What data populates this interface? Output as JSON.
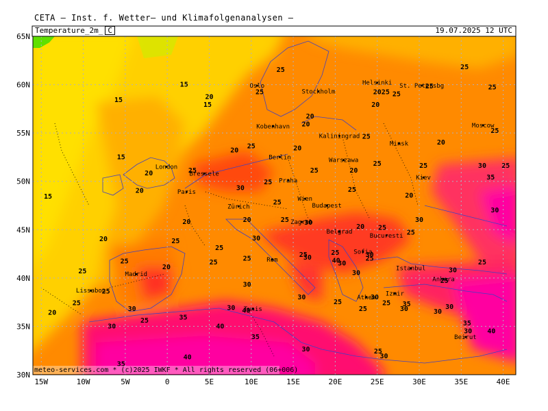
{
  "header": {
    "title": "CETA — Inst. f. Wetter— und Klimafolgenanalysen —"
  },
  "subheader": {
    "parameter": "Temperature_2m_",
    "unit": "C",
    "valid_time": "19.07.2025 12 UTC"
  },
  "footer": {
    "credit": "meteo-services.com * (c)2025 IWKF * All rights reserved (06+006)"
  },
  "map": {
    "lat_labels": [
      "65N",
      "60N",
      "55N",
      "50N",
      "45N",
      "40N",
      "35N",
      "30N"
    ],
    "lon_labels": [
      "15W",
      "10W",
      "5W",
      "0",
      "5E",
      "10E",
      "15E",
      "20E",
      "25E",
      "30E",
      "35E",
      "40E"
    ],
    "colors": {
      "temp_15": "#ffd800",
      "temp_20": "#ffb000",
      "temp_25": "#ff8a00",
      "temp_30": "#ff5a00",
      "temp_35": "#ff2a3a",
      "temp_40": "#ff00a0",
      "cold_green": "#60e000",
      "lime": "#c8f000",
      "border": "#4040c0",
      "grid": "#b0b0c0"
    },
    "cities": [
      {
        "name": "Oslo",
        "lon": 10.7,
        "lat": 59.9
      },
      {
        "name": "Stockholm",
        "lon": 18.0,
        "lat": 59.3
      },
      {
        "name": "Helsinki",
        "lon": 25.0,
        "lat": 60.2
      },
      {
        "name": "St. Petersbg",
        "lon": 30.3,
        "lat": 59.9
      },
      {
        "name": "Kobenhavn",
        "lon": 12.6,
        "lat": 55.7
      },
      {
        "name": "Kaliningrad",
        "lon": 20.5,
        "lat": 54.7
      },
      {
        "name": "Minsk",
        "lon": 27.6,
        "lat": 53.9
      },
      {
        "name": "Moscow",
        "lon": 37.6,
        "lat": 55.8
      },
      {
        "name": "London",
        "lon": -0.1,
        "lat": 51.5
      },
      {
        "name": "Berlin",
        "lon": 13.4,
        "lat": 52.5
      },
      {
        "name": "Warszawa",
        "lon": 21.0,
        "lat": 52.2
      },
      {
        "name": "Bressele",
        "lon": 4.4,
        "lat": 50.8
      },
      {
        "name": "Praha",
        "lon": 14.4,
        "lat": 50.1
      },
      {
        "name": "Kiev",
        "lon": 30.5,
        "lat": 50.4
      },
      {
        "name": "Paris",
        "lon": 2.3,
        "lat": 48.9
      },
      {
        "name": "Wien",
        "lon": 16.4,
        "lat": 48.2
      },
      {
        "name": "Zürich",
        "lon": 8.5,
        "lat": 47.4
      },
      {
        "name": "Budapest",
        "lon": 19.0,
        "lat": 47.5
      },
      {
        "name": "Zagreb",
        "lon": 16.0,
        "lat": 45.8
      },
      {
        "name": "Bucuresti",
        "lon": 26.1,
        "lat": 44.4
      },
      {
        "name": "Belgrad",
        "lon": 20.5,
        "lat": 44.8
      },
      {
        "name": "Sofia",
        "lon": 23.3,
        "lat": 42.7
      },
      {
        "name": "Istanbul",
        "lon": 29.0,
        "lat": 41.0
      },
      {
        "name": "Rom",
        "lon": 12.5,
        "lat": 41.9
      },
      {
        "name": "Madrid",
        "lon": -3.7,
        "lat": 40.4
      },
      {
        "name": "Ankara",
        "lon": 32.9,
        "lat": 39.9
      },
      {
        "name": "Lissabon",
        "lon": -9.1,
        "lat": 38.7
      },
      {
        "name": "Athen",
        "lon": 23.7,
        "lat": 38.0
      },
      {
        "name": "Izmir",
        "lon": 27.1,
        "lat": 38.4
      },
      {
        "name": "Tunis",
        "lon": 10.2,
        "lat": 36.8
      },
      {
        "name": "Beirut",
        "lon": 35.5,
        "lat": 33.9
      }
    ],
    "contour_labels": [
      {
        "t": "25",
        "lon": 13.5,
        "lat": 61.3
      },
      {
        "t": "25",
        "lon": 11.0,
        "lat": 59.0
      },
      {
        "t": "15",
        "lon": 2.0,
        "lat": 59.8
      },
      {
        "t": "20",
        "lon": 5.0,
        "lat": 58.5
      },
      {
        "t": "15",
        "lon": -5.8,
        "lat": 58.2
      },
      {
        "t": "15",
        "lon": 4.8,
        "lat": 57.7
      },
      {
        "t": "2025",
        "lon": 25.5,
        "lat": 59.0
      },
      {
        "t": "25",
        "lon": 27.3,
        "lat": 58.8
      },
      {
        "t": "25",
        "lon": 31.2,
        "lat": 59.6
      },
      {
        "t": "25",
        "lon": 35.4,
        "lat": 61.6
      },
      {
        "t": "25",
        "lon": 38.7,
        "lat": 59.5
      },
      {
        "t": "20",
        "lon": 24.8,
        "lat": 57.7
      },
      {
        "t": "20",
        "lon": 17.0,
        "lat": 56.5
      },
      {
        "t": "20",
        "lon": 16.5,
        "lat": 55.7
      },
      {
        "t": "25",
        "lon": 23.7,
        "lat": 54.4
      },
      {
        "t": "20",
        "lon": 32.6,
        "lat": 53.8
      },
      {
        "t": "25",
        "lon": 39.0,
        "lat": 55.0
      },
      {
        "t": "20",
        "lon": 8.0,
        "lat": 53.0
      },
      {
        "t": "25",
        "lon": 10.0,
        "lat": 53.4
      },
      {
        "t": "20",
        "lon": 15.5,
        "lat": 53.2
      },
      {
        "t": "15",
        "lon": -5.5,
        "lat": 52.3
      },
      {
        "t": "20",
        "lon": -2.2,
        "lat": 50.6
      },
      {
        "t": "25",
        "lon": 3.0,
        "lat": 50.9
      },
      {
        "t": "25",
        "lon": 17.5,
        "lat": 50.9
      },
      {
        "t": "20",
        "lon": 22.2,
        "lat": 50.9
      },
      {
        "t": "25",
        "lon": 25.0,
        "lat": 51.6
      },
      {
        "t": "25",
        "lon": 30.5,
        "lat": 51.4
      },
      {
        "t": "30",
        "lon": 37.5,
        "lat": 51.4
      },
      {
        "t": "25",
        "lon": 40.3,
        "lat": 51.4
      },
      {
        "t": "35",
        "lon": 38.5,
        "lat": 50.2
      },
      {
        "t": "20",
        "lon": -3.3,
        "lat": 48.8
      },
      {
        "t": "30",
        "lon": 8.7,
        "lat": 49.1
      },
      {
        "t": "25",
        "lon": 12.0,
        "lat": 49.7
      },
      {
        "t": "25",
        "lon": 22.0,
        "lat": 48.9
      },
      {
        "t": "20",
        "lon": 28.8,
        "lat": 48.3
      },
      {
        "t": "15",
        "lon": -14.2,
        "lat": 48.2
      },
      {
        "t": "25",
        "lon": 13.1,
        "lat": 47.6
      },
      {
        "t": "30",
        "lon": 39.0,
        "lat": 46.8
      },
      {
        "t": "20",
        "lon": 2.3,
        "lat": 45.6
      },
      {
        "t": "20",
        "lon": 9.5,
        "lat": 45.8
      },
      {
        "t": "25",
        "lon": 14.0,
        "lat": 45.8
      },
      {
        "t": "30",
        "lon": 16.8,
        "lat": 45.5
      },
      {
        "t": "20",
        "lon": 23.0,
        "lat": 45.1
      },
      {
        "t": "25",
        "lon": 25.6,
        "lat": 45.0
      },
      {
        "t": "30",
        "lon": 30.0,
        "lat": 45.8
      },
      {
        "t": "25",
        "lon": 29.0,
        "lat": 44.5
      },
      {
        "t": "20",
        "lon": -7.6,
        "lat": 43.8
      },
      {
        "t": "25",
        "lon": 1.0,
        "lat": 43.6
      },
      {
        "t": "25",
        "lon": 6.2,
        "lat": 42.9
      },
      {
        "t": "30",
        "lon": 10.6,
        "lat": 43.9
      },
      {
        "t": "30",
        "lon": 16.7,
        "lat": 41.9
      },
      {
        "t": "25",
        "lon": 16.2,
        "lat": 42.2
      },
      {
        "t": "25",
        "lon": 20.0,
        "lat": 42.4
      },
      {
        "t": "40",
        "lon": 20.1,
        "lat": 41.6
      },
      {
        "t": "30",
        "lon": 20.8,
        "lat": 41.3
      },
      {
        "t": "30",
        "lon": 24.1,
        "lat": 42.2
      },
      {
        "t": "25",
        "lon": 24.1,
        "lat": 41.8
      },
      {
        "t": "25",
        "lon": -5.1,
        "lat": 41.5
      },
      {
        "t": "25",
        "lon": -10.1,
        "lat": 40.5
      },
      {
        "t": "20",
        "lon": -0.1,
        "lat": 40.9
      },
      {
        "t": "25",
        "lon": 5.5,
        "lat": 41.4
      },
      {
        "t": "25",
        "lon": 9.5,
        "lat": 41.8
      },
      {
        "t": "25",
        "lon": 37.5,
        "lat": 41.4
      },
      {
        "t": "30",
        "lon": 22.5,
        "lat": 40.3
      },
      {
        "t": "30",
        "lon": 34.0,
        "lat": 40.6
      },
      {
        "t": "25",
        "lon": 33.0,
        "lat": 39.5
      },
      {
        "t": "30",
        "lon": 9.5,
        "lat": 39.1
      },
      {
        "t": "30",
        "lon": 16.0,
        "lat": 37.8
      },
      {
        "t": "25",
        "lon": -7.3,
        "lat": 38.4
      },
      {
        "t": "25",
        "lon": -10.8,
        "lat": 37.2
      },
      {
        "t": "30",
        "lon": -4.2,
        "lat": 36.6
      },
      {
        "t": "25",
        "lon": 20.3,
        "lat": 37.3
      },
      {
        "t": "30",
        "lon": 24.7,
        "lat": 37.8
      },
      {
        "t": "25",
        "lon": 26.1,
        "lat": 37.2
      },
      {
        "t": "30",
        "lon": 33.6,
        "lat": 36.8
      },
      {
        "t": "35",
        "lon": 28.5,
        "lat": 37.1
      },
      {
        "t": "30",
        "lon": 28.2,
        "lat": 36.6
      },
      {
        "t": "30",
        "lon": 32.2,
        "lat": 36.3
      },
      {
        "t": "25",
        "lon": 23.3,
        "lat": 36.6
      },
      {
        "t": "30",
        "lon": 7.6,
        "lat": 36.7
      },
      {
        "t": "40",
        "lon": 9.4,
        "lat": 36.4
      },
      {
        "t": "20",
        "lon": -13.7,
        "lat": 36.2
      },
      {
        "t": "25",
        "lon": -2.7,
        "lat": 35.4
      },
      {
        "t": "35",
        "lon": 1.9,
        "lat": 35.7
      },
      {
        "t": "40",
        "lon": 6.3,
        "lat": 34.8
      },
      {
        "t": "30",
        "lon": -6.6,
        "lat": 34.8
      },
      {
        "t": "35",
        "lon": 35.7,
        "lat": 35.1
      },
      {
        "t": "30",
        "lon": 35.8,
        "lat": 34.3
      },
      {
        "t": "40",
        "lon": 38.6,
        "lat": 34.3
      },
      {
        "t": "35",
        "lon": 10.5,
        "lat": 33.7
      },
      {
        "t": "30",
        "lon": 16.5,
        "lat": 32.4
      },
      {
        "t": "25",
        "lon": 25.1,
        "lat": 32.2
      },
      {
        "t": "30",
        "lon": 25.8,
        "lat": 31.7
      },
      {
        "t": "40",
        "lon": 2.4,
        "lat": 31.6
      },
      {
        "t": "35",
        "lon": -5.5,
        "lat": 30.9
      }
    ]
  }
}
